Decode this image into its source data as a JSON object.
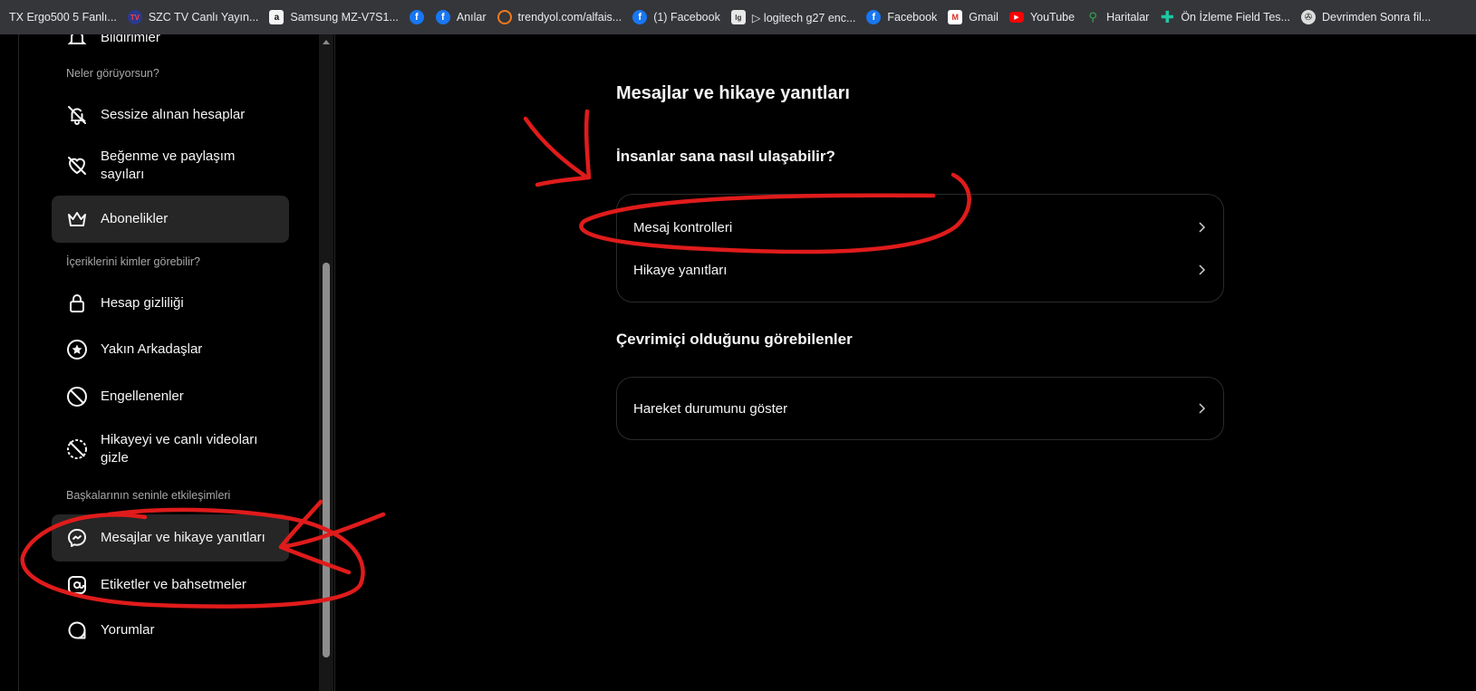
{
  "bookmarks": [
    {
      "label": "TX Ergo500 5 Fanlı...",
      "icon": "none"
    },
    {
      "label": "SZC TV Canlı Yayın...",
      "icon": "tv-icon"
    },
    {
      "label": "Samsung MZ-V7S1...",
      "icon": "amazon-icon"
    },
    {
      "label": "",
      "icon": "facebook-icon"
    },
    {
      "label": "Anılar",
      "icon": "facebook-icon"
    },
    {
      "label": "trendyol.com/alfais...",
      "icon": "trendyol-icon"
    },
    {
      "label": "(1) Facebook",
      "icon": "facebook-icon"
    },
    {
      "label": "▷ logitech g27 enc...",
      "icon": "logitech-icon"
    },
    {
      "label": "Facebook",
      "icon": "facebook-icon"
    },
    {
      "label": "Gmail",
      "icon": "gmail-icon"
    },
    {
      "label": "YouTube",
      "icon": "youtube-icon"
    },
    {
      "label": "Haritalar",
      "icon": "maps-icon"
    },
    {
      "label": "Ön İzleme Field Tes...",
      "icon": "plus-icon"
    },
    {
      "label": "Devrimden Sonra fil...",
      "icon": "film-reel-icon"
    }
  ],
  "sidebar": {
    "partial_top_label": "Bildirimler",
    "sections": {
      "what_you_see": "Neler görüyorsun?",
      "who_sees": "İçeriklerini kimler görebilir?",
      "interactions": "Başkalarının seninle etkileşimleri"
    },
    "items": {
      "muted": "Sessize alınan hesaplar",
      "likes": "Beğenme ve paylaşım sayıları",
      "subscriptions": "Abonelikler",
      "privacy": "Hesap gizliliği",
      "close_friends": "Yakın Arkadaşlar",
      "blocked": "Engellenenler",
      "hide_story": "Hikayeyi ve canlı videoları gizle",
      "messages": "Mesajlar ve hikaye yanıtları",
      "tags": "Etiketler ve bahsetmeler",
      "comments": "Yorumlar"
    }
  },
  "main": {
    "title": "Mesajlar ve hikaye yanıtları",
    "section1": {
      "title": "İnsanlar sana nasıl ulaşabilir?",
      "rows": [
        "Mesaj kontrolleri",
        "Hikaye yanıtları"
      ]
    },
    "section2": {
      "title": "Çevrimiçi olduğunu görebilenler",
      "rows": [
        "Hareket durumunu göster"
      ]
    }
  },
  "colors": {
    "background": "#000000",
    "active_item": "#262626",
    "annotation_red": "#e01b1b",
    "text": "#f5f5f5",
    "muted_text": "#a8a8a8"
  }
}
